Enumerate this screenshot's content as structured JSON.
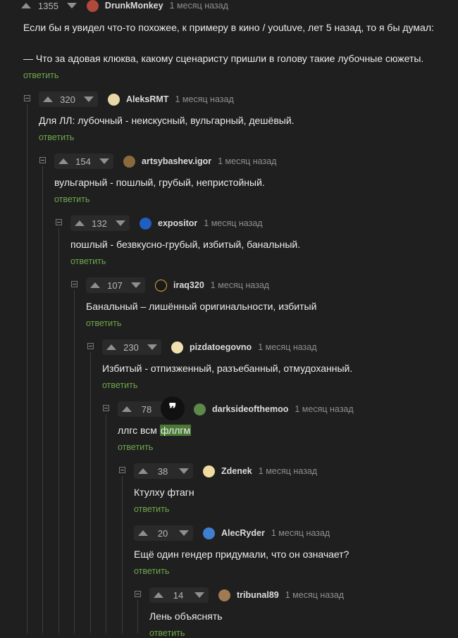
{
  "comments": [
    {
      "score": "1355",
      "user": "DrunkMonkey",
      "time": "1 месяц назад",
      "text1": "Если бы я увидел что-то похожее, к примеру в кино / youtuve, лет 5 назад, то я бы думал:",
      "text2": "— Что за адовая клюква, какому сценаристу пришли в голову такие лубочные сюжеты.",
      "reply": "ответить",
      "avatar_color": "#b04a3a"
    },
    {
      "score": "320",
      "user": "AleksRMT",
      "time": "1 месяц назад",
      "text1": "Для ЛЛ: лубочный - неискусный, вульгарный, дешёвый.",
      "reply": "ответить",
      "avatar_color": "#e8d7a8"
    },
    {
      "score": "154",
      "user": "artsybashev.igor",
      "time": "1 месяц назад",
      "text1": "вульгарный - пошлый, грубый, непристойный.",
      "reply": "ответить",
      "avatar_color": "#8a6a3a"
    },
    {
      "score": "132",
      "user": "expositor",
      "time": "1 месяц назад",
      "text1": "пошлый - безвкусно-грубый, избитый, банальный.",
      "reply": "ответить",
      "avatar_color": "#1f5fbf"
    },
    {
      "score": "107",
      "user": "iraq320",
      "time": "1 месяц назад",
      "text1": "Банальный – лишённый оригинальности, избитый",
      "reply": "ответить",
      "avatar_color": "#d9a53a"
    },
    {
      "score": "230",
      "user": "pizdatoegovno",
      "time": "1 месяц назад",
      "text1": "Избитый - отпизженный, разъебанный, отмудоханный.",
      "reply": "ответить",
      "avatar_color": "#f0e0b0"
    },
    {
      "score": "78",
      "user": "darksideofthemoo",
      "time": "1 месяц назад",
      "text1": "ллгс всм ",
      "text_hl": "фллгм",
      "reply": "ответить",
      "avatar_color": "#5d8a4a"
    },
    {
      "score": "38",
      "user": "Zdenek",
      "time": "1 месяц назад",
      "text1": "Ктулху фтагн",
      "reply": "ответить",
      "avatar_color": "#f0dca0"
    },
    {
      "score": "20",
      "user": "AlecRyder",
      "time": "1 месяц назад",
      "text1": "Ещё один гендер придумали, что он означает?",
      "reply": "ответить",
      "avatar_color": "#3f7fd0"
    },
    {
      "score": "14",
      "user": "tribunal89",
      "time": "1 месяц назад",
      "text1": "Лень объяснять",
      "reply": "ответить",
      "avatar_color": "#a07a50"
    }
  ],
  "quote_icon": "quote-icon",
  "quote_glyph": "❞"
}
